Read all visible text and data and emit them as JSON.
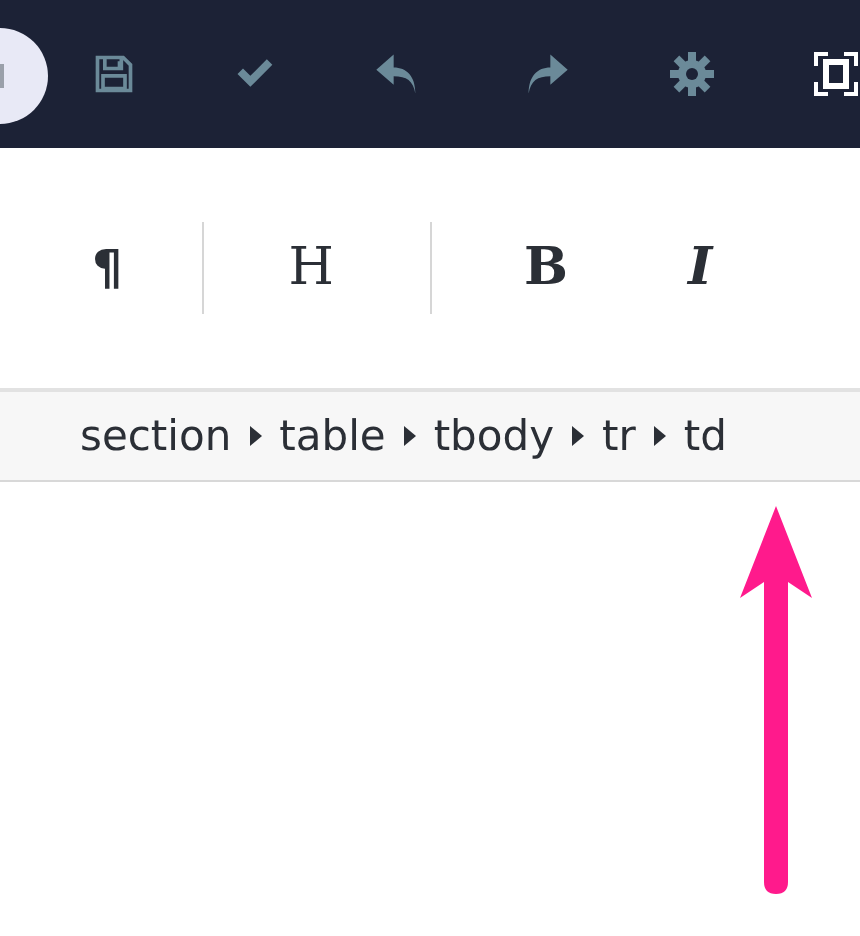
{
  "toolbar": {
    "buttons": [
      {
        "kind": "save"
      },
      {
        "kind": "check"
      },
      {
        "kind": "undo"
      },
      {
        "kind": "redo"
      },
      {
        "kind": "settings"
      },
      {
        "kind": "fullscreen"
      }
    ]
  },
  "format_buttons": [
    {
      "label": "¶",
      "kind": "paragraph"
    },
    {
      "label": "H",
      "kind": "heading"
    },
    {
      "label": "B",
      "kind": "bold"
    },
    {
      "label": "I",
      "kind": "italic"
    }
  ],
  "breadcrumb": [
    "section",
    "table",
    "tbody",
    "tr",
    "td"
  ]
}
